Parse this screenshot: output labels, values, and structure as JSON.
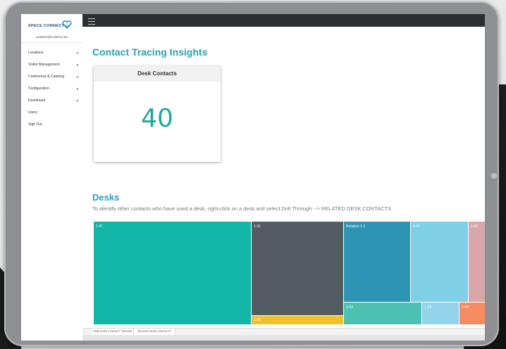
{
  "colors": {
    "accent": "#27a3b4",
    "kpi": "#1fa79a",
    "topbar": "#2b2d30",
    "active_tab": "#f2c12e"
  },
  "app": {
    "brand": "SPACE CONNECT",
    "user_email": "scadmin@scdemo.net"
  },
  "sidebar": {
    "items": [
      {
        "label": "Locations",
        "chevron": true
      },
      {
        "label": "Visitor Management",
        "chevron": true
      },
      {
        "label": "Conference & Catering",
        "chevron": true
      },
      {
        "label": "Configuration",
        "chevron": true
      },
      {
        "label": "Dashboard",
        "chevron": true
      },
      {
        "label": "Users",
        "chevron": false
      },
      {
        "label": "Sign Out",
        "chevron": false
      }
    ]
  },
  "report": {
    "title": "Contact Tracing Insights",
    "card": {
      "label": "Desk Contacts",
      "value": "40"
    },
    "desks_title": "Desks",
    "desks_subtitle": "To identify other contacts who have used a desk, right-click on a desk and select Drill Through --> RELATED DESK CONTACTS",
    "treemap": [
      {
        "label": "1-01",
        "color": "#12b5a6"
      },
      {
        "label": "1-31",
        "color": "#525c61"
      },
      {
        "label": "1-03",
        "color": "#f2c12e"
      },
      {
        "label": "Rotation 1-1",
        "color": "#2e94b4"
      },
      {
        "label": "1-07",
        "color": "#7fcfe6"
      },
      {
        "label": "1-09",
        "color": "#d9a7a9"
      },
      {
        "label": "1-52",
        "color": "#4bc0b3"
      },
      {
        "label": "1-29",
        "color": "#92d3ea"
      },
      {
        "label": "1-44",
        "color": "#f58c61"
      }
    ]
  },
  "page_tabs": [
    {
      "label": "EMPLOYEE CONTACT TRACING",
      "active": true
    },
    {
      "label": "RELATED DESK CONTACTS",
      "active": false
    }
  ]
}
